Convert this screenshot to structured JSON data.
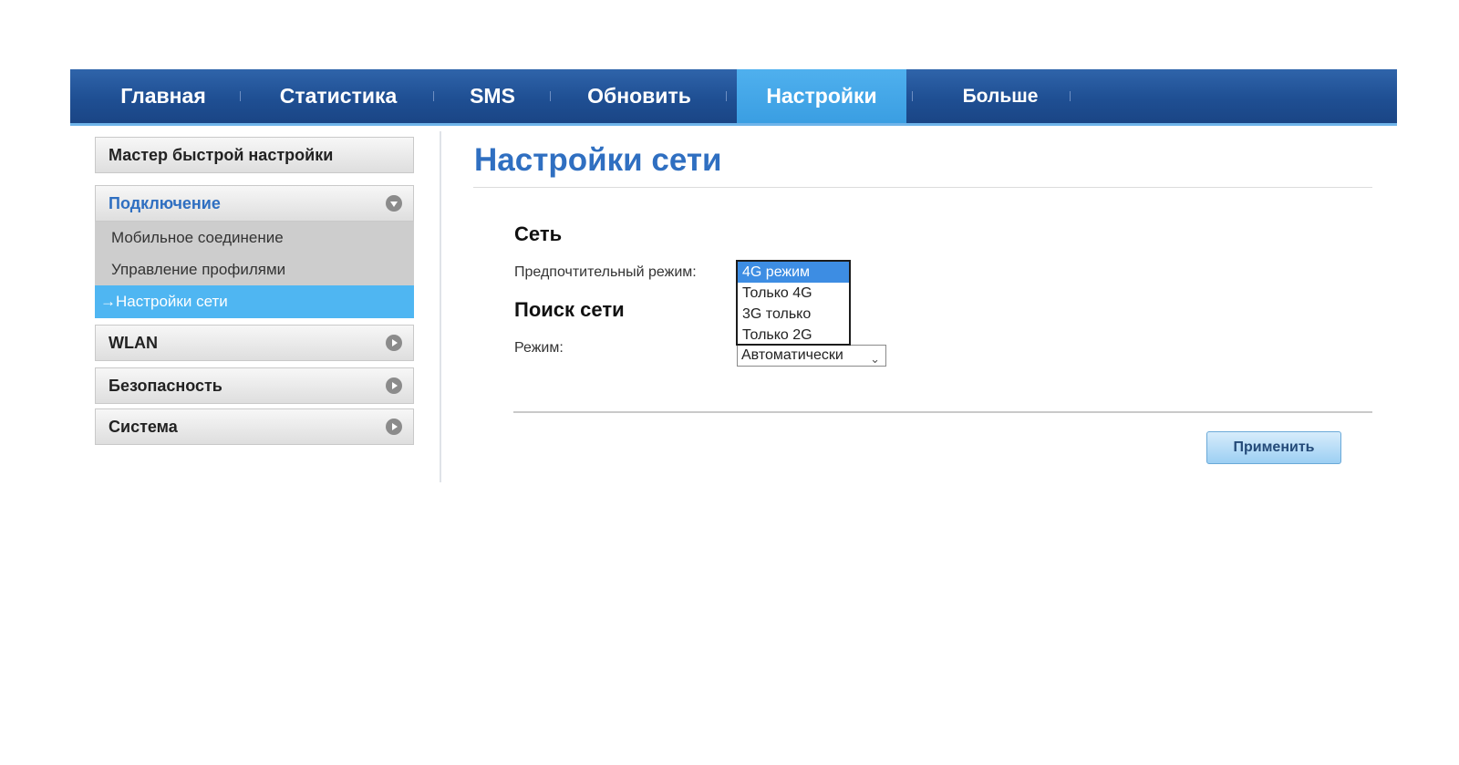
{
  "topnav": {
    "tabs": [
      {
        "label": "Главная"
      },
      {
        "label": "Статистика"
      },
      {
        "label": "SMS"
      },
      {
        "label": "Обновить"
      },
      {
        "label": "Настройки",
        "active": true
      },
      {
        "label": "Больше"
      }
    ]
  },
  "sidebar": {
    "quick_setup": "Мастер быстрой настройки",
    "connection": "Подключение",
    "connection_items": [
      "Мобильное соединение",
      "Управление профилями",
      "→Настройки сети"
    ],
    "wlan": "WLAN",
    "security": "Безопасность",
    "system": "Система"
  },
  "main": {
    "title": "Настройки сети",
    "network_section": "Сеть",
    "preferred_mode_label": "Предпочтительный режим:",
    "preferred_mode_options": [
      "4G режим",
      "Только 4G",
      "3G только",
      "Только 2G"
    ],
    "preferred_mode_selected": "4G режим",
    "search_section": "Поиск сети",
    "mode_label": "Режим:",
    "mode_value": "Автоматически",
    "apply_label": "Применить"
  },
  "colors": {
    "nav_blue": "#1f4f93",
    "active_tab": "#4fb0ee",
    "title_blue": "#2f6fc1",
    "selected_option": "#3d8de3"
  }
}
